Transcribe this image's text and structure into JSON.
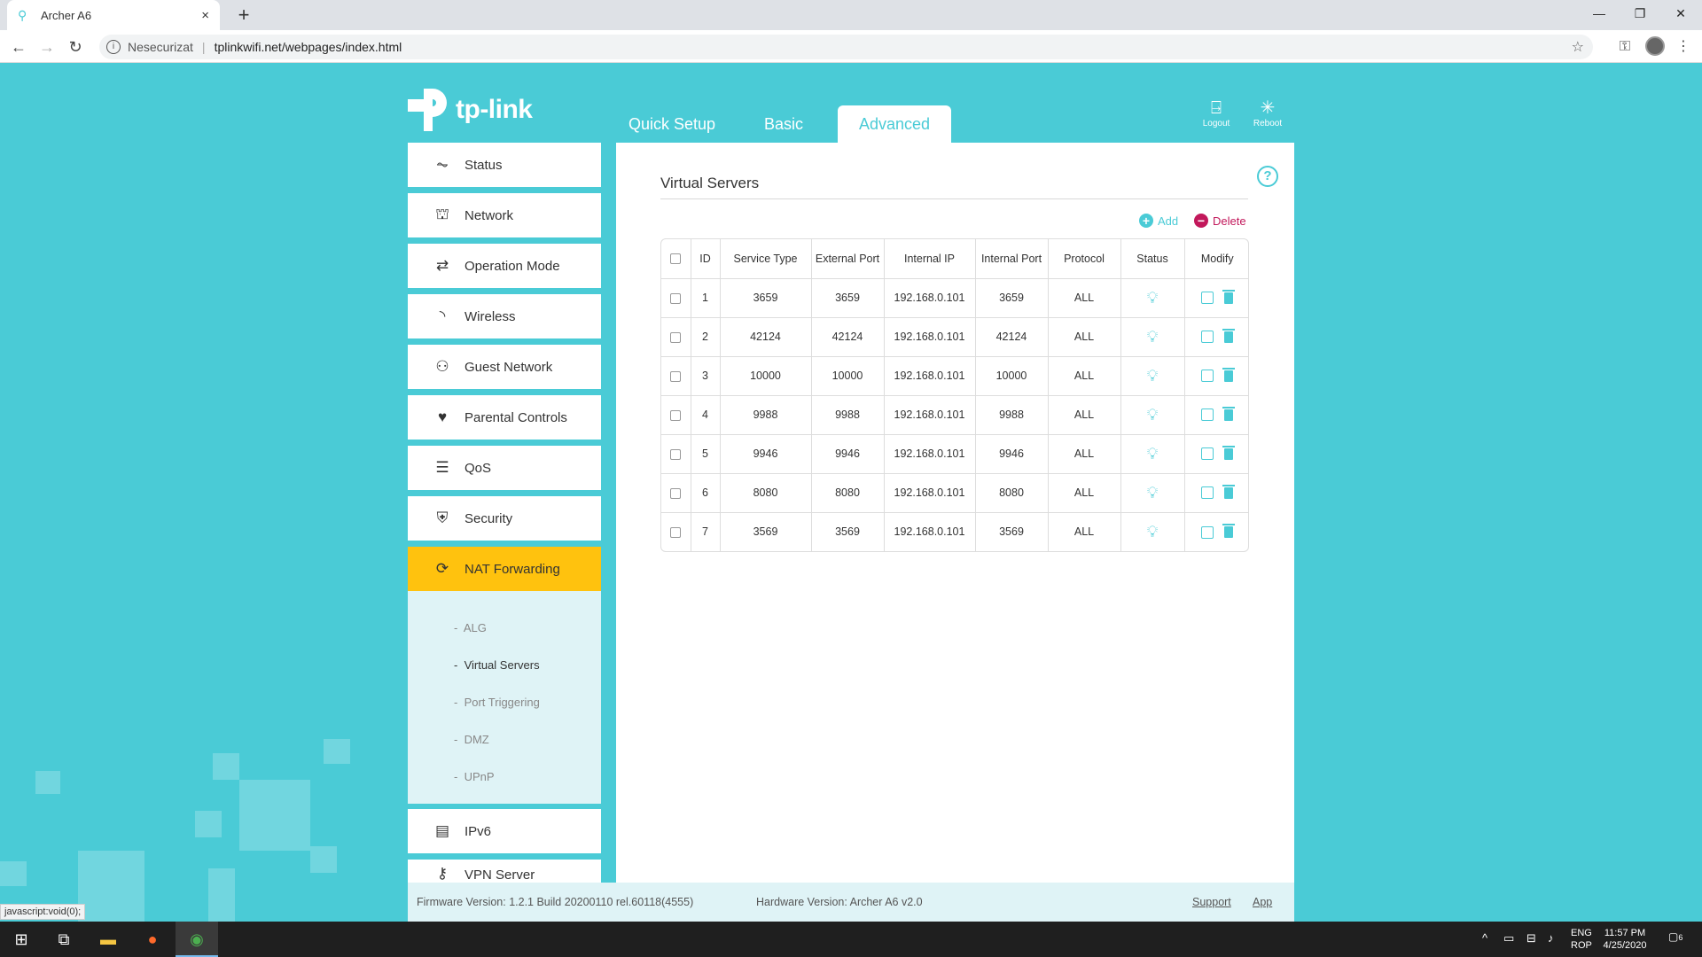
{
  "browser": {
    "tab_title": "Archer A6",
    "tab_close": "×",
    "new_tab": "+",
    "security_label": "Nesecurizat",
    "url": "tplinkwifi.net/webpages/index.html",
    "status_link": "javascript:void(0);"
  },
  "header": {
    "logo_text": "tp-link",
    "nav": [
      "Quick Setup",
      "Basic",
      "Advanced"
    ],
    "active_nav": "Advanced",
    "logout_label": "Logout",
    "reboot_label": "Reboot"
  },
  "sidebar": {
    "items": [
      {
        "label": "Status",
        "icon": "pulse-icon"
      },
      {
        "label": "Network",
        "icon": "network-icon"
      },
      {
        "label": "Operation Mode",
        "icon": "mode-icon"
      },
      {
        "label": "Wireless",
        "icon": "wifi-icon"
      },
      {
        "label": "Guest Network",
        "icon": "guest-icon"
      },
      {
        "label": "Parental Controls",
        "icon": "family-icon"
      },
      {
        "label": "QoS",
        "icon": "qos-icon"
      },
      {
        "label": "Security",
        "icon": "shield-icon"
      },
      {
        "label": "NAT Forwarding",
        "icon": "nat-icon"
      },
      {
        "label": "IPv6",
        "icon": "ipv6-icon"
      },
      {
        "label": "VPN Server",
        "icon": "vpn-icon"
      }
    ],
    "active_item": "NAT Forwarding",
    "submenu": [
      "ALG",
      "Virtual Servers",
      "Port Triggering",
      "DMZ",
      "UPnP"
    ],
    "active_sub": "Virtual Servers"
  },
  "main": {
    "title": "Virtual Servers",
    "add_label": "Add",
    "delete_label": "Delete",
    "columns": [
      "",
      "ID",
      "Service Type",
      "External Port",
      "Internal IP",
      "Internal Port",
      "Protocol",
      "Status",
      "Modify"
    ],
    "rows": [
      {
        "id": "1",
        "service": "3659",
        "ext": "3659",
        "ip": "192.168.0.101",
        "int": "3659",
        "proto": "ALL"
      },
      {
        "id": "2",
        "service": "42124",
        "ext": "42124",
        "ip": "192.168.0.101",
        "int": "42124",
        "proto": "ALL"
      },
      {
        "id": "3",
        "service": "10000",
        "ext": "10000",
        "ip": "192.168.0.101",
        "int": "10000",
        "proto": "ALL"
      },
      {
        "id": "4",
        "service": "9988",
        "ext": "9988",
        "ip": "192.168.0.101",
        "int": "9988",
        "proto": "ALL"
      },
      {
        "id": "5",
        "service": "9946",
        "ext": "9946",
        "ip": "192.168.0.101",
        "int": "9946",
        "proto": "ALL"
      },
      {
        "id": "6",
        "service": "8080",
        "ext": "8080",
        "ip": "192.168.0.101",
        "int": "8080",
        "proto": "ALL"
      },
      {
        "id": "7",
        "service": "3569",
        "ext": "3569",
        "ip": "192.168.0.101",
        "int": "3569",
        "proto": "ALL"
      }
    ]
  },
  "footer": {
    "firmware": "Firmware Version: 1.2.1 Build 20200110 rel.60118(4555)",
    "hardware": "Hardware Version: Archer A6 v2.0",
    "support": "Support",
    "app": "App"
  },
  "taskbar": {
    "lang1": "ENG",
    "lang2": "ROP",
    "time": "11:57 PM",
    "date": "4/25/2020",
    "notifications": "6"
  },
  "colors": {
    "accent": "#4acbd6",
    "active_menu": "#ffc20e",
    "delete": "#c2185b"
  }
}
